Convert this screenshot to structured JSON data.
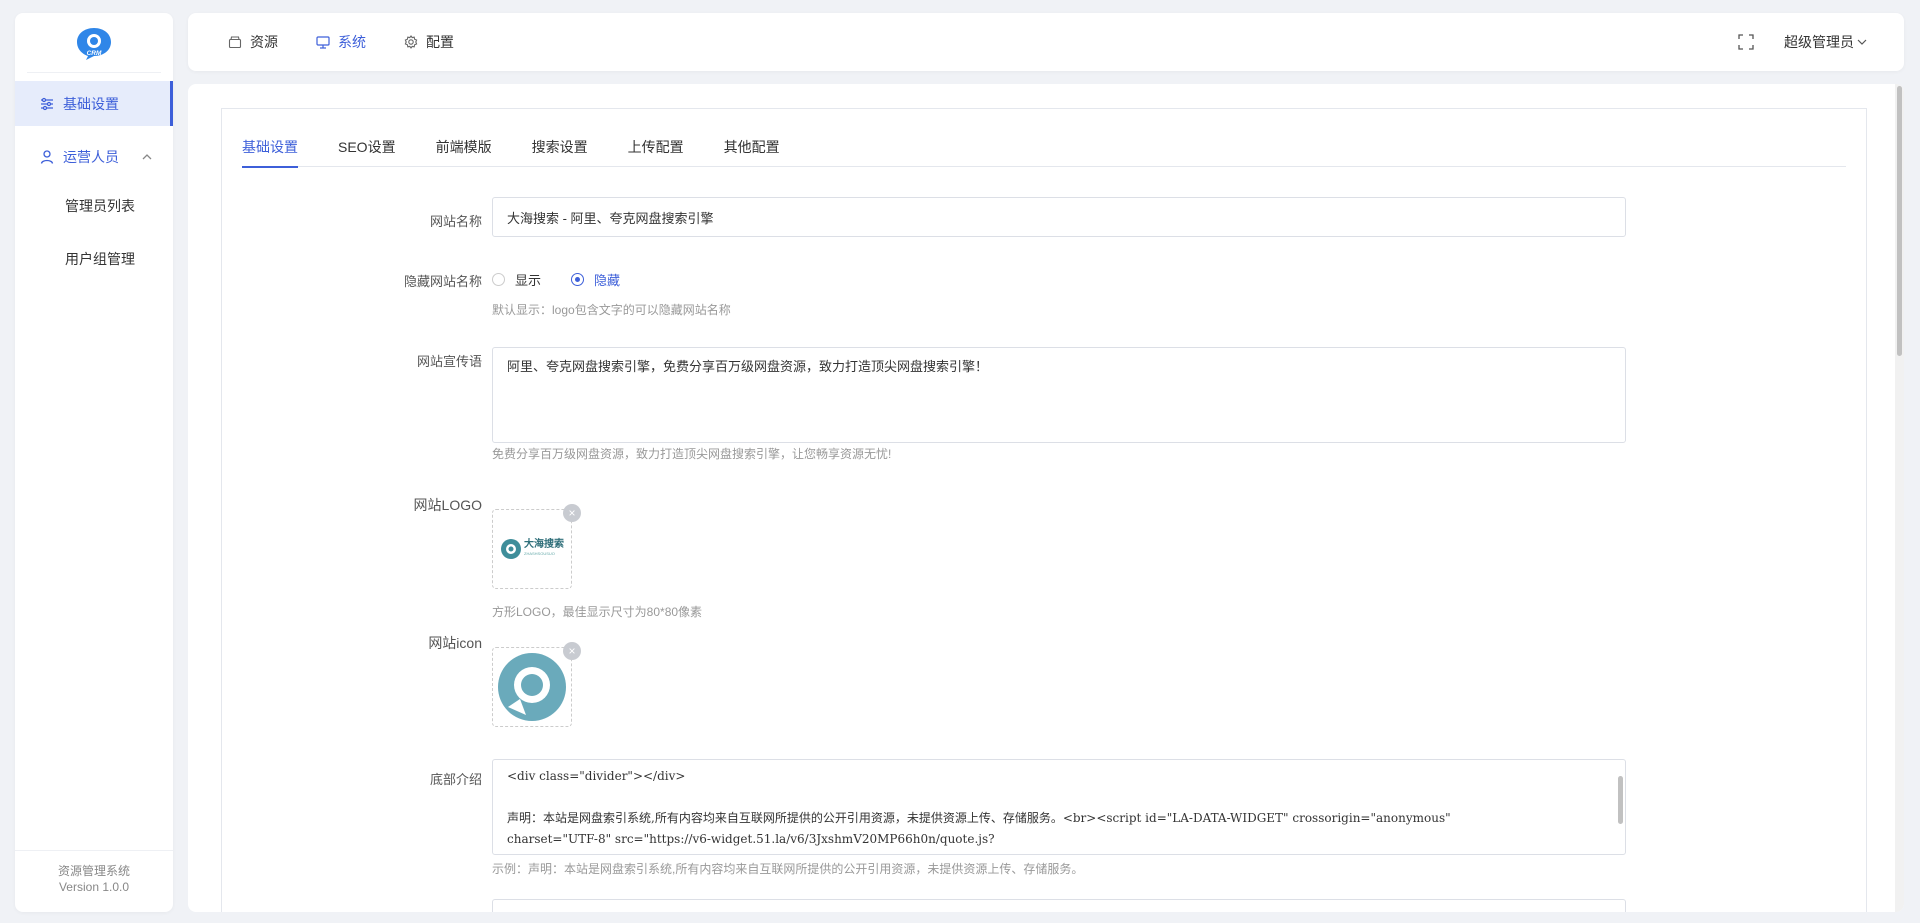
{
  "sidebar": {
    "items": [
      {
        "label": "基础设置",
        "icon": "sliders-icon"
      },
      {
        "label": "运营人员",
        "icon": "user-icon"
      }
    ],
    "sub_items": [
      "管理员列表",
      "用户组管理"
    ],
    "footer": {
      "name": "资源管理系统",
      "version": "Version 1.0.0"
    }
  },
  "topbar": {
    "tabs": [
      {
        "label": "资源",
        "icon": "box-icon"
      },
      {
        "label": "系统",
        "icon": "monitor-icon"
      },
      {
        "label": "配置",
        "icon": "gear-icon"
      }
    ],
    "user": "超级管理员"
  },
  "tabs": [
    "基础设置",
    "SEO设置",
    "前端模版",
    "搜索设置",
    "上传配置",
    "其他配置"
  ],
  "form": {
    "site_name": {
      "label": "网站名称",
      "value": "大海搜索 - 阿里、夸克网盘搜索引擎"
    },
    "hide_name": {
      "label": "隐藏网站名称",
      "options": [
        "显示",
        "隐藏"
      ],
      "selected": "隐藏",
      "hint": "默认显示：logo包含文字的可以隐藏网站名称"
    },
    "slogan": {
      "label": "网站宣传语",
      "value": "阿里、夸克网盘搜索引擎，免费分享百万级网盘资源，致力打造顶尖网盘搜索引擎！",
      "hint": "免费分享百万级网盘资源，致力打造顶尖网盘搜索引擎，让您畅享资源无忧!"
    },
    "logo": {
      "label": "网站LOGO",
      "hint": "方形LOGO，最佳显示尺寸为80*80像素",
      "logo_text": "大海搜索",
      "logo_sub": "ZHASHSOUSUO"
    },
    "icon": {
      "label": "网站icon"
    },
    "footer": {
      "label": "底部介绍",
      "line1": "<div class=\"divider\"></div>",
      "line2": "声明：本站是网盘索引系统,所有内容均来自互联网所提供的公开引用资源，未提供资源上传、存储服务。<br><script id=\"LA-DATA-WIDGET\" crossorigin=\"anonymous\"",
      "line3": "charset=\"UTF-8\" src=\"https://v6-widget.51.la/v6/3JxshmV20MP66h0n/quote.js?",
      "hint": "示例：声明：本站是网盘索引系统,所有内容均来自互联网所提供的公开引用资源，未提供资源上传、存储服务。"
    }
  },
  "colors": {
    "accent": "#3d5fd9",
    "bg": "#f0f2f6"
  }
}
